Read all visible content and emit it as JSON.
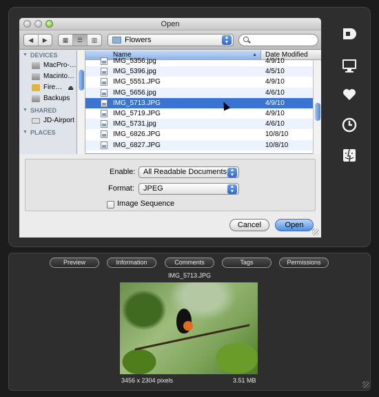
{
  "dialog": {
    "title": "Open",
    "path_folder": "Flowers",
    "view_buttons": [
      "icon-view",
      "list-view",
      "column-view"
    ],
    "search_placeholder": ""
  },
  "sidebar": {
    "sections": [
      {
        "label": "DEVICES",
        "items": [
          {
            "label": "MacPro-…",
            "icon": "computer-icon"
          },
          {
            "label": "Macinto…",
            "icon": "hard-drive-icon"
          },
          {
            "label": "Fire…",
            "icon": "firewire-drive-icon",
            "eject": true
          },
          {
            "label": "Backups",
            "icon": "hard-drive-icon"
          }
        ]
      },
      {
        "label": "SHARED",
        "items": [
          {
            "label": "JD-Airport",
            "icon": "network-icon"
          }
        ]
      },
      {
        "label": "PLACES",
        "items": []
      }
    ]
  },
  "file_list": {
    "columns": {
      "name": "Name",
      "date": "Date Modified"
    },
    "rows": [
      {
        "name": "IMG_5356.jpg",
        "date": "4/9/10"
      },
      {
        "name": "IMG_5396.jpg",
        "date": "4/5/10"
      },
      {
        "name": "IMG_5551.JPG",
        "date": "4/9/10"
      },
      {
        "name": "IMG_5656.jpg",
        "date": "4/6/10"
      },
      {
        "name": "IMG_5713.JPG",
        "date": "4/9/10",
        "selected": true
      },
      {
        "name": "IMG_5719.JPG",
        "date": "4/9/10"
      },
      {
        "name": "IMG_5731.jpg",
        "date": "4/6/10"
      },
      {
        "name": "IMG_6826.JPG",
        "date": "10/8/10"
      },
      {
        "name": "IMG_6827.JPG",
        "date": "10/8/10"
      }
    ]
  },
  "options": {
    "enable_label": "Enable:",
    "enable_value": "All Readable Documents",
    "format_label": "Format:",
    "format_value": "JPEG",
    "image_sequence_label": "Image Sequence",
    "image_sequence_checked": false
  },
  "buttons": {
    "cancel": "Cancel",
    "open": "Open"
  },
  "right_icons": [
    "drive-icon",
    "monitor-icon",
    "heart-icon",
    "clock-icon",
    "finder-icon"
  ],
  "preview": {
    "tabs": [
      "Preview",
      "Information",
      "Comments",
      "Tags",
      "Permissions"
    ],
    "filename": "IMG_5713.JPG",
    "dimensions": "3456 x 2304 pixels",
    "size": "3.51 MB"
  }
}
